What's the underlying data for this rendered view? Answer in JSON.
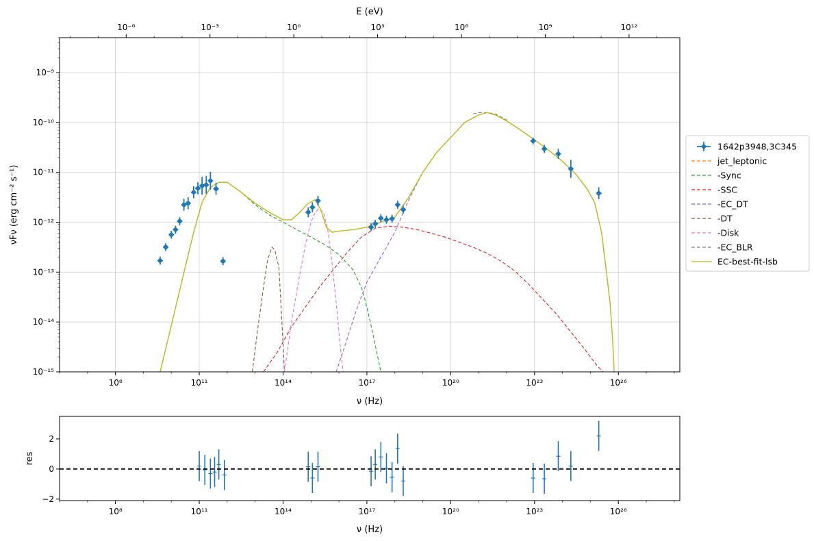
{
  "chart_data": [
    {
      "type": "line",
      "xscale": "log",
      "yscale": "log",
      "xlim_log10": [
        6.0,
        28.2
      ],
      "ylim_log10": [
        -15,
        -8.3
      ],
      "xlabel": "ν  (Hz)",
      "ylabel": "νFν  (erg cm⁻²  s⁻¹)",
      "top_axis_label": "E (eV)",
      "top_axis_ticks": [
        "10⁻⁶",
        "10⁻³",
        "10⁰",
        "10³",
        "10⁶",
        "10⁹",
        "10¹²"
      ],
      "top_axis_ticks_log10_eV": [
        -6,
        -3,
        0,
        3,
        6,
        9,
        12
      ],
      "x_ticks": [
        "10⁸",
        "10¹¹",
        "10¹⁴",
        "10¹⁷",
        "10²⁰",
        "10²³",
        "10²⁶"
      ],
      "x_ticks_log10": [
        8,
        11,
        14,
        17,
        20,
        23,
        26
      ],
      "y_ticks": [
        "10⁻⁹",
        "10⁻¹⁰",
        "10⁻¹¹",
        "10⁻¹²",
        "10⁻¹³",
        "10⁻¹⁴",
        "10⁻¹⁵"
      ],
      "y_ticks_log10": [
        -9,
        -10,
        -11,
        -12,
        -13,
        -14,
        -15
      ],
      "grid": true,
      "legend_position": "outside-right",
      "legend": [
        {
          "label": "1642p3948,3C345",
          "color": "#1f77b4",
          "style": "errorbar"
        },
        {
          "label": "jet_leptonic",
          "color": "#ff7f0e",
          "style": "dashed"
        },
        {
          "label": "  -Sync",
          "color": "#2ca02c",
          "style": "dashed"
        },
        {
          "label": "  -SSC",
          "color": "#d62728",
          "style": "dashed"
        },
        {
          "label": "  -EC_DT",
          "color": "#9467bd",
          "style": "dashed"
        },
        {
          "label": "  -DT",
          "color": "#8c564b",
          "style": "dashed"
        },
        {
          "label": "  -Disk",
          "color": "#e377c2",
          "style": "dashed"
        },
        {
          "label": "  -EC_BLR",
          "color": "#7f7f7f",
          "style": "dashed"
        },
        {
          "label": "EC-best-fit-lsb",
          "color": "#bcbd22",
          "style": "solid"
        }
      ],
      "data_points_log10": {
        "x": [
          9.6,
          9.8,
          10.0,
          10.15,
          10.3,
          10.45,
          10.6,
          10.8,
          10.95,
          11.1,
          11.25,
          11.4,
          11.6,
          11.85,
          14.9,
          15.05,
          15.25,
          17.15,
          17.3,
          17.5,
          17.7,
          17.9,
          18.1,
          18.3,
          22.95,
          23.35,
          23.85,
          24.3,
          25.3
        ],
        "y": [
          -12.77,
          -12.5,
          -12.25,
          -12.15,
          -11.98,
          -11.65,
          -11.62,
          -11.4,
          -11.32,
          -11.27,
          -11.25,
          -11.17,
          -11.33,
          -12.78,
          -11.8,
          -11.7,
          -11.57,
          -12.1,
          -12.03,
          -11.92,
          -11.95,
          -11.93,
          -11.65,
          -11.75,
          -10.37,
          -10.53,
          -10.63,
          -10.93,
          -11.42
        ],
        "yerr": [
          0.08,
          0.08,
          0.08,
          0.08,
          0.08,
          0.12,
          0.12,
          0.12,
          0.12,
          0.18,
          0.18,
          0.18,
          0.12,
          0.08,
          0.1,
          0.1,
          0.1,
          0.08,
          0.08,
          0.08,
          0.08,
          0.08,
          0.08,
          0.08,
          0.07,
          0.08,
          0.1,
          0.18,
          0.12
        ]
      },
      "series": [
        {
          "key": "sync",
          "color": "#2ca02c",
          "dash": "5,3",
          "x": [
            9.6,
            9.9,
            10.2,
            10.5,
            10.8,
            11.1,
            11.4,
            11.7,
            12.0,
            12.5,
            13.0,
            13.5,
            14.0,
            14.5,
            15.0,
            15.5,
            16.0,
            16.5,
            16.8,
            17.0,
            17.2,
            17.35,
            17.5
          ],
          "y": [
            -15.0,
            -14.3,
            -13.6,
            -12.9,
            -12.2,
            -11.6,
            -11.3,
            -11.2,
            -11.2,
            -11.4,
            -11.65,
            -11.85,
            -12.0,
            -12.15,
            -12.3,
            -12.45,
            -12.65,
            -12.95,
            -13.3,
            -13.7,
            -14.2,
            -14.6,
            -15.0
          ]
        },
        {
          "key": "ssc",
          "color": "#d62728",
          "dash": "5,3",
          "x": [
            13.3,
            13.8,
            14.3,
            14.8,
            15.3,
            15.8,
            16.3,
            16.8,
            17.3,
            17.8,
            18.3,
            18.8,
            19.3,
            19.8,
            20.3,
            20.8,
            21.3,
            21.8,
            22.3,
            22.8,
            23.3,
            23.8,
            24.3,
            24.8,
            25.2,
            25.45
          ],
          "y": [
            -15.0,
            -14.6,
            -14.1,
            -13.7,
            -13.3,
            -12.95,
            -12.6,
            -12.3,
            -12.12,
            -12.08,
            -12.1,
            -12.15,
            -12.22,
            -12.3,
            -12.4,
            -12.5,
            -12.62,
            -12.78,
            -12.98,
            -13.25,
            -13.55,
            -13.85,
            -14.2,
            -14.55,
            -14.85,
            -15.0
          ]
        },
        {
          "key": "ec_dt",
          "color": "#9467bd",
          "dash": "5,3",
          "x": [
            15.9,
            16.2,
            16.6,
            17.0,
            17.5,
            18.0,
            18.5,
            19.0,
            19.5,
            20.0,
            20.5,
            21.0,
            21.3,
            21.6,
            22.0,
            22.5,
            23.0,
            23.5,
            24.0,
            24.5,
            24.9,
            25.15,
            25.4,
            25.55,
            25.7,
            25.8,
            25.85
          ],
          "y": [
            -15.0,
            -14.5,
            -13.8,
            -13.2,
            -12.7,
            -12.2,
            -11.55,
            -11.0,
            -10.6,
            -10.3,
            -10.0,
            -9.85,
            -9.8,
            -9.85,
            -9.97,
            -10.15,
            -10.35,
            -10.55,
            -10.78,
            -11.05,
            -11.35,
            -11.6,
            -12.2,
            -12.9,
            -13.6,
            -14.4,
            -15.0
          ]
        },
        {
          "key": "dt",
          "color": "#8c564b",
          "dash": "5,3",
          "x": [
            12.9,
            13.1,
            13.3,
            13.45,
            13.6,
            13.7,
            13.85,
            13.95,
            14.05
          ],
          "y": [
            -15.0,
            -14.1,
            -13.3,
            -12.75,
            -12.5,
            -12.55,
            -12.9,
            -13.9,
            -15.0
          ]
        },
        {
          "key": "disk",
          "color": "#e377c2",
          "dash": "5,3",
          "x": [
            14.05,
            14.3,
            14.55,
            14.8,
            15.0,
            15.15,
            15.3,
            15.45,
            15.6,
            15.75,
            15.9,
            16.05,
            16.15
          ],
          "y": [
            -15.0,
            -14.0,
            -13.2,
            -12.45,
            -12.0,
            -11.8,
            -11.72,
            -11.82,
            -12.15,
            -12.8,
            -13.6,
            -14.5,
            -15.0
          ]
        },
        {
          "key": "ec_blr",
          "color": "#7f7f7f",
          "dash": "5,3",
          "x": [
            20.8,
            21.0,
            21.3,
            21.6,
            22.0
          ],
          "y": [
            -9.83,
            -9.8,
            -9.8,
            -9.83,
            -9.95
          ]
        },
        {
          "key": "jet_leptonic",
          "color": "#ff7f0e",
          "dash": "5,3",
          "x": [
            9.6,
            9.9,
            10.2,
            10.5,
            10.8,
            11.1,
            11.4,
            11.7,
            12.0,
            12.5,
            13.0,
            13.5,
            14.0,
            14.3,
            14.6,
            14.9,
            15.15,
            15.35,
            15.55,
            15.75,
            16.0,
            16.5,
            17.0,
            17.5,
            18.0,
            18.5,
            19.0,
            19.5,
            20.0,
            20.5,
            21.0,
            21.3,
            21.6,
            22.0,
            22.5,
            23.0,
            23.5,
            24.0,
            24.5,
            24.9,
            25.15,
            25.4,
            25.55,
            25.7,
            25.8,
            25.85
          ],
          "y": [
            -15.0,
            -14.3,
            -13.6,
            -12.9,
            -12.2,
            -11.6,
            -11.3,
            -11.2,
            -11.2,
            -11.4,
            -11.62,
            -11.8,
            -11.95,
            -11.95,
            -11.8,
            -11.62,
            -11.55,
            -11.75,
            -12.1,
            -12.2,
            -12.18,
            -12.15,
            -12.1,
            -12.0,
            -11.9,
            -11.5,
            -11.0,
            -10.6,
            -10.3,
            -10.0,
            -9.85,
            -9.8,
            -9.85,
            -9.97,
            -10.15,
            -10.35,
            -10.55,
            -10.78,
            -11.05,
            -11.35,
            -11.6,
            -12.2,
            -12.9,
            -13.6,
            -14.4,
            -15.0
          ]
        },
        {
          "key": "ec_best_fit_lsb",
          "color": "#bcbd22",
          "dash": "",
          "x": [
            9.6,
            9.9,
            10.2,
            10.5,
            10.8,
            11.1,
            11.4,
            11.7,
            12.0,
            12.5,
            13.0,
            13.5,
            14.0,
            14.3,
            14.6,
            14.9,
            15.15,
            15.35,
            15.55,
            15.75,
            16.0,
            16.5,
            17.0,
            17.5,
            18.0,
            18.5,
            19.0,
            19.5,
            20.0,
            20.5,
            21.0,
            21.3,
            21.6,
            22.0,
            22.5,
            23.0,
            23.5,
            24.0,
            24.5,
            24.9,
            25.15,
            25.4,
            25.55,
            25.7,
            25.8,
            25.85
          ],
          "y": [
            -15.0,
            -14.3,
            -13.6,
            -12.9,
            -12.2,
            -11.6,
            -11.3,
            -11.2,
            -11.2,
            -11.4,
            -11.62,
            -11.8,
            -11.95,
            -11.95,
            -11.8,
            -11.62,
            -11.55,
            -11.75,
            -12.1,
            -12.2,
            -12.18,
            -12.15,
            -12.1,
            -12.0,
            -11.9,
            -11.5,
            -11.0,
            -10.6,
            -10.3,
            -10.0,
            -9.85,
            -9.8,
            -9.85,
            -9.97,
            -10.15,
            -10.35,
            -10.55,
            -10.78,
            -11.05,
            -11.35,
            -11.6,
            -12.2,
            -12.9,
            -13.6,
            -14.4,
            -15.0
          ]
        }
      ]
    },
    {
      "type": "scatter",
      "xscale": "log",
      "xlim_log10": [
        6.0,
        28.2
      ],
      "ylim": [
        -2.1,
        3.5
      ],
      "xlabel": "ν  (Hz)",
      "ylabel": "res",
      "x_ticks": [
        "10⁸",
        "10¹¹",
        "10¹⁴",
        "10¹⁷",
        "10²⁰",
        "10²³",
        "10²⁶"
      ],
      "x_ticks_log10": [
        8,
        11,
        14,
        17,
        20,
        23,
        26
      ],
      "y_ticks": [
        "2",
        "0",
        "−2"
      ],
      "y_ticks_values": [
        2,
        0,
        -2
      ],
      "reference_line": 0,
      "residuals": {
        "x_log10": [
          11.0,
          11.2,
          11.4,
          11.55,
          11.7,
          11.9,
          14.9,
          15.05,
          15.25,
          17.15,
          17.3,
          17.5,
          17.7,
          17.9,
          18.1,
          18.3,
          22.95,
          23.35,
          23.85,
          24.3,
          25.3
        ],
        "y": [
          0.2,
          -0.05,
          -0.3,
          -0.2,
          0.3,
          -0.4,
          0.15,
          -0.6,
          0.15,
          -0.15,
          0.3,
          0.8,
          0.05,
          -0.55,
          1.35,
          -0.8,
          -0.6,
          -0.65,
          0.85,
          0.2,
          2.2
        ],
        "yerr": [
          1.0,
          1.0,
          1.0,
          1.0,
          1.0,
          1.0,
          1.0,
          1.0,
          1.0,
          1.0,
          1.0,
          1.0,
          1.0,
          1.0,
          1.0,
          1.0,
          1.0,
          1.0,
          1.0,
          1.0,
          1.0
        ]
      }
    }
  ]
}
